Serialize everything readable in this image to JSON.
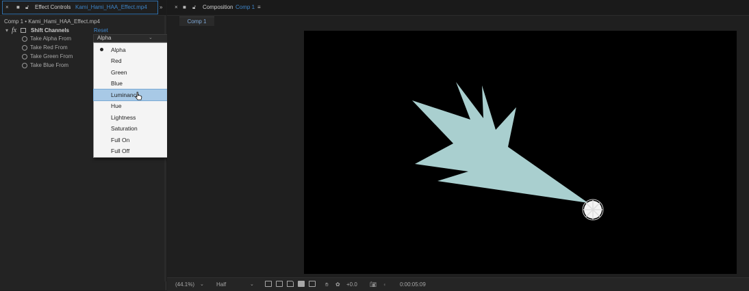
{
  "left_panel": {
    "tab_title": "Effect Controls",
    "tab_file": "Kami_Hami_HAA_Effect.mp4",
    "source_line": "Comp 1 • Kami_Hami_HAA_Effect.mp4",
    "fx_label": "fx",
    "effect_name": "Shift Channels",
    "reset_label": "Reset",
    "properties": [
      {
        "label": "Take Alpha From"
      },
      {
        "label": "Take Red From"
      },
      {
        "label": "Take Green From"
      },
      {
        "label": "Take Blue From"
      }
    ],
    "dropdown_value": "Alpha",
    "dropdown_options": [
      {
        "label": "Alpha",
        "selected": true
      },
      {
        "label": "Red"
      },
      {
        "label": "Green"
      },
      {
        "label": "Blue"
      },
      {
        "label": "Luminance",
        "highlighted": true
      },
      {
        "label": "Hue"
      },
      {
        "label": "Lightness"
      },
      {
        "label": "Saturation"
      },
      {
        "label": "Full On"
      },
      {
        "label": "Full Off"
      }
    ]
  },
  "right_panel": {
    "tab_title": "Composition",
    "tab_comp": "Comp 1",
    "subtab": "Comp 1",
    "bottom_bar": {
      "zoom": "(44.1%)",
      "resolution": "Half",
      "exposure": "+0.0",
      "timecode": "0:00:05:09"
    }
  },
  "colors": {
    "accent": "#2f6ea8",
    "link": "#3d84c8",
    "shape": "#a9cfcf",
    "menu_highlight": "#a8c9e6"
  }
}
